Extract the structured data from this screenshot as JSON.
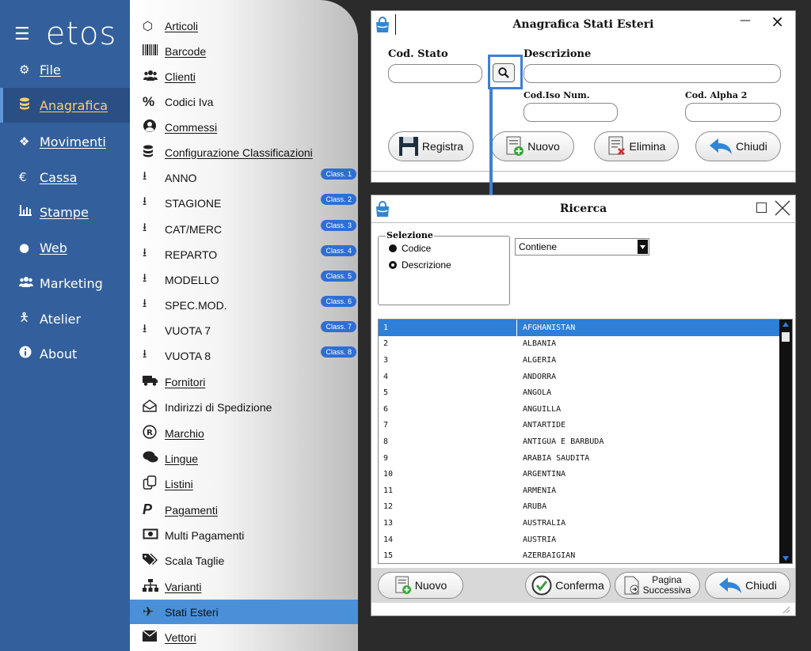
{
  "nav": {
    "logo": "etos",
    "items": [
      {
        "label": "File",
        "icon": "gear-icon",
        "active": false
      },
      {
        "label": "Anagrafica",
        "icon": "database-icon",
        "active": true
      },
      {
        "label": "Movimenti",
        "icon": "cubes-icon",
        "active": false
      },
      {
        "label": "Cassa",
        "icon": "euro-icon",
        "active": false
      },
      {
        "label": "Stampe",
        "icon": "bar-chart-icon",
        "active": false
      },
      {
        "label": "Web",
        "icon": "globe-icon",
        "active": false
      },
      {
        "label": "Marketing",
        "icon": "users-icon",
        "active": false
      },
      {
        "label": "Atelier",
        "icon": "person-icon",
        "active": false
      },
      {
        "label": "About",
        "icon": "info-icon",
        "active": false
      }
    ]
  },
  "submenu": {
    "items": [
      {
        "label": "Articoli",
        "icon": "cube-icon"
      },
      {
        "label": "Barcode",
        "icon": "barcode-icon"
      },
      {
        "label": "Clienti",
        "icon": "users-icon"
      },
      {
        "label": "Codici Iva",
        "icon": "percent-icon"
      },
      {
        "label": "Commessi",
        "icon": "user-circle-icon"
      },
      {
        "label": "Configurazione Classificazioni",
        "icon": "database-icon"
      },
      {
        "label": "ANNO",
        "icon": "sort-icon",
        "badge": "Class. 1"
      },
      {
        "label": "STAGIONE",
        "icon": "sort-icon",
        "badge": "Class. 2"
      },
      {
        "label": "CAT/MERC",
        "icon": "sort-icon",
        "badge": "Class. 3"
      },
      {
        "label": "REPARTO",
        "icon": "sort-icon",
        "badge": "Class. 4"
      },
      {
        "label": "MODELLO",
        "icon": "sort-icon",
        "badge": "Class. 5"
      },
      {
        "label": "SPEC.MOD.",
        "icon": "sort-icon",
        "badge": "Class. 6"
      },
      {
        "label": "VUOTA 7",
        "icon": "sort-icon",
        "badge": "Class. 7"
      },
      {
        "label": "VUOTA 8",
        "icon": "sort-icon",
        "badge": "Class. 8"
      },
      {
        "label": "Fornitori",
        "icon": "truck-icon"
      },
      {
        "label": "Indirizzi di Spedizione",
        "icon": "envelope-open-icon"
      },
      {
        "label": "Marchio",
        "icon": "registered-icon"
      },
      {
        "label": "Lingue",
        "icon": "comments-icon"
      },
      {
        "label": "Listini",
        "icon": "copy-icon"
      },
      {
        "label": "Pagamenti",
        "icon": "paypal-icon"
      },
      {
        "label": "Multi Pagamenti",
        "icon": "money-icon"
      },
      {
        "label": "Scala Taglie",
        "icon": "tags-icon"
      },
      {
        "label": "Varianti",
        "icon": "sitemap-icon"
      },
      {
        "label": "Stati Esteri",
        "icon": "plane-icon",
        "active": true
      },
      {
        "label": "Vettori",
        "icon": "envelope-icon"
      }
    ]
  },
  "anagrafica": {
    "title": "Anagrafica Stati Esteri",
    "cod_stato_label": "Cod. Stato",
    "descrizione_label": "Descrizione",
    "iso_label": "Cod.Iso Num.",
    "alpha_label": "Cod. Alpha 2",
    "cod_stato_value": "",
    "descrizione_value": "",
    "iso_value": "",
    "alpha_value": "",
    "btn_registra": "Registra",
    "btn_nuovo": "Nuovo",
    "btn_elimina": "Elimina",
    "btn_chiudi": "Chiudi",
    "minimize": "—",
    "close": "×"
  },
  "ricerca": {
    "title": "Ricerca",
    "selezione_label": "Selezione",
    "radio_codice": "Codice",
    "radio_descrizione": "Descrizione",
    "mode_value": "Contiene",
    "rows": [
      {
        "code": "1",
        "name": "AFGHANISTAN"
      },
      {
        "code": "2",
        "name": "ALBANIA"
      },
      {
        "code": "3",
        "name": "ALGERIA"
      },
      {
        "code": "4",
        "name": "ANDORRA"
      },
      {
        "code": "5",
        "name": "ANGOLA"
      },
      {
        "code": "6",
        "name": "ANGUILLA"
      },
      {
        "code": "7",
        "name": "ANTARTIDE"
      },
      {
        "code": "8",
        "name": "ANTIGUA E BARBUDA"
      },
      {
        "code": "9",
        "name": "ARABIA SAUDITA"
      },
      {
        "code": "10",
        "name": "ARGENTINA"
      },
      {
        "code": "11",
        "name": "ARMENIA"
      },
      {
        "code": "12",
        "name": "ARUBA"
      },
      {
        "code": "13",
        "name": "AUSTRALIA"
      },
      {
        "code": "14",
        "name": "AUSTRIA"
      },
      {
        "code": "15",
        "name": "AZERBAIGIAN"
      }
    ],
    "btn_nuovo": "Nuovo",
    "btn_conferma": "Conferma",
    "btn_pagina_1": "Pagina",
    "btn_pagina_2": "Successiva",
    "btn_chiudi": "Chiudi"
  },
  "colors": {
    "nav_bg": "#33609c",
    "accent": "#2d7fd8",
    "annotation": "#3d7fd6"
  }
}
